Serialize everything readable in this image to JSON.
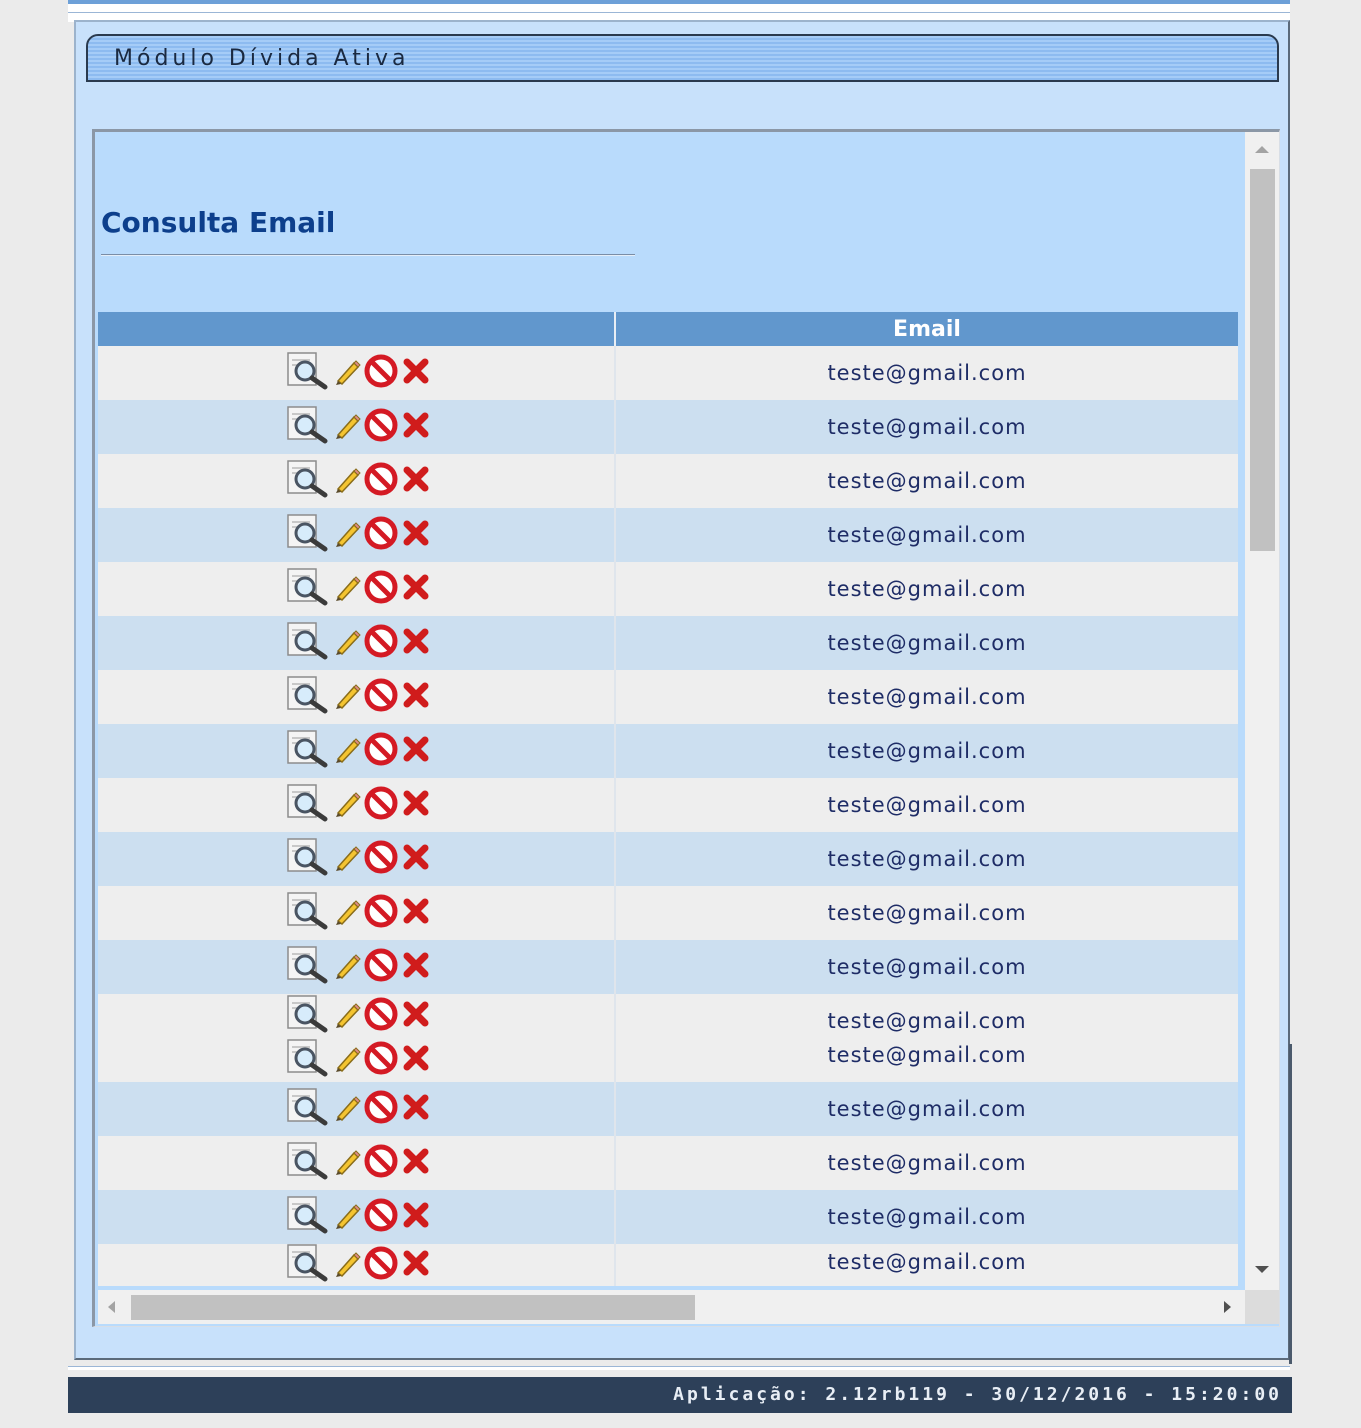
{
  "module": {
    "title": "Módulo Dívida Ativa"
  },
  "page": {
    "title": "Consulta Email"
  },
  "table": {
    "columns": [
      "",
      "Email"
    ],
    "rows": [
      {
        "emails": [
          "teste@gmail.com"
        ]
      },
      {
        "emails": [
          "teste@gmail.com"
        ]
      },
      {
        "emails": [
          "teste@gmail.com"
        ]
      },
      {
        "emails": [
          "teste@gmail.com"
        ]
      },
      {
        "emails": [
          "teste@gmail.com"
        ]
      },
      {
        "emails": [
          "teste@gmail.com"
        ]
      },
      {
        "emails": [
          "teste@gmail.com"
        ]
      },
      {
        "emails": [
          "teste@gmail.com"
        ]
      },
      {
        "emails": [
          "teste@gmail.com"
        ]
      },
      {
        "emails": [
          "teste@gmail.com"
        ]
      },
      {
        "emails": [
          "teste@gmail.com"
        ]
      },
      {
        "emails": [
          "teste@gmail.com"
        ]
      },
      {
        "emails": [
          "teste@gmail.com",
          "teste@gmail.com"
        ]
      },
      {
        "emails": [
          "teste@gmail.com"
        ]
      },
      {
        "emails": [
          "teste@gmail.com"
        ]
      },
      {
        "emails": [
          "teste@gmail.com"
        ]
      },
      {
        "emails": [
          "teste@gmail.com"
        ]
      }
    ],
    "row_actions": [
      "view-icon",
      "edit-icon",
      "block-icon",
      "delete-icon"
    ]
  },
  "footer": {
    "text": "Aplicação: 2.12rb119 - 30/12/2016 - 15:20:00"
  },
  "colors": {
    "header_bg": "#6197cd",
    "row_odd": "#eeeeee",
    "row_even": "#ccdff0",
    "title": "#0d3f8c",
    "footer_bg": "#2d4059"
  }
}
